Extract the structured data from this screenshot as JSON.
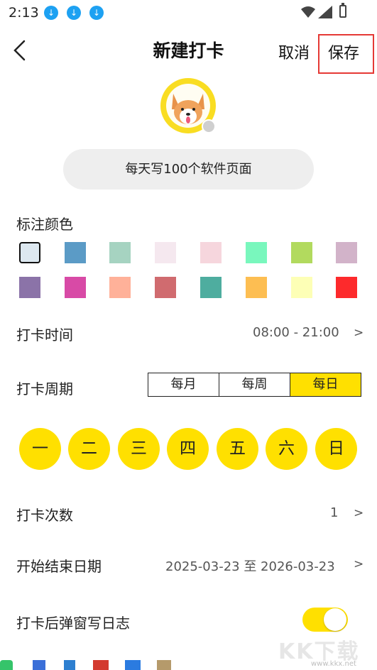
{
  "status_bar": {
    "time": "2:13"
  },
  "nav": {
    "title": "新建打卡",
    "cancel_label": "取消",
    "save_label": "保存"
  },
  "habit_name": "每天写100个软件页面",
  "color_section": {
    "label": "标注颜色",
    "colors": [
      "#dde8f0",
      "#5b9bc6",
      "#a6d3c1",
      "#f5e8ef",
      "#f6d6dd",
      "#79f7bd",
      "#b2da5e",
      "#d2b3c9",
      "#8b73a8",
      "#d84aa6",
      "#ffb199",
      "#d06b6f",
      "#4ead9f",
      "#fdbe52",
      "#fdffb6",
      "#fd2a2c"
    ],
    "selected_index": 0
  },
  "time_row": {
    "label": "打卡时间",
    "value": "08:00 - 21:00",
    "chevron": ">"
  },
  "period_row": {
    "label": "打卡周期",
    "options": [
      "每月",
      "每周",
      "每日"
    ],
    "selected": "每日"
  },
  "weekdays": [
    "一",
    "二",
    "三",
    "四",
    "五",
    "六",
    "日"
  ],
  "count_row": {
    "label": "打卡次数",
    "value": "1",
    "chevron": ">"
  },
  "date_row": {
    "label": "开始结束日期",
    "value": "2025-03-23 至 2026-03-23",
    "chevron": ">"
  },
  "diary_row": {
    "label": "打卡后弹窗写日志",
    "enabled": true
  },
  "watermark": {
    "text": "KK下载",
    "url": "www.kkx.net"
  },
  "colors": {
    "accent": "#ffe000",
    "highlight_border": "#e53935",
    "download_badge": "#1da1f2"
  }
}
